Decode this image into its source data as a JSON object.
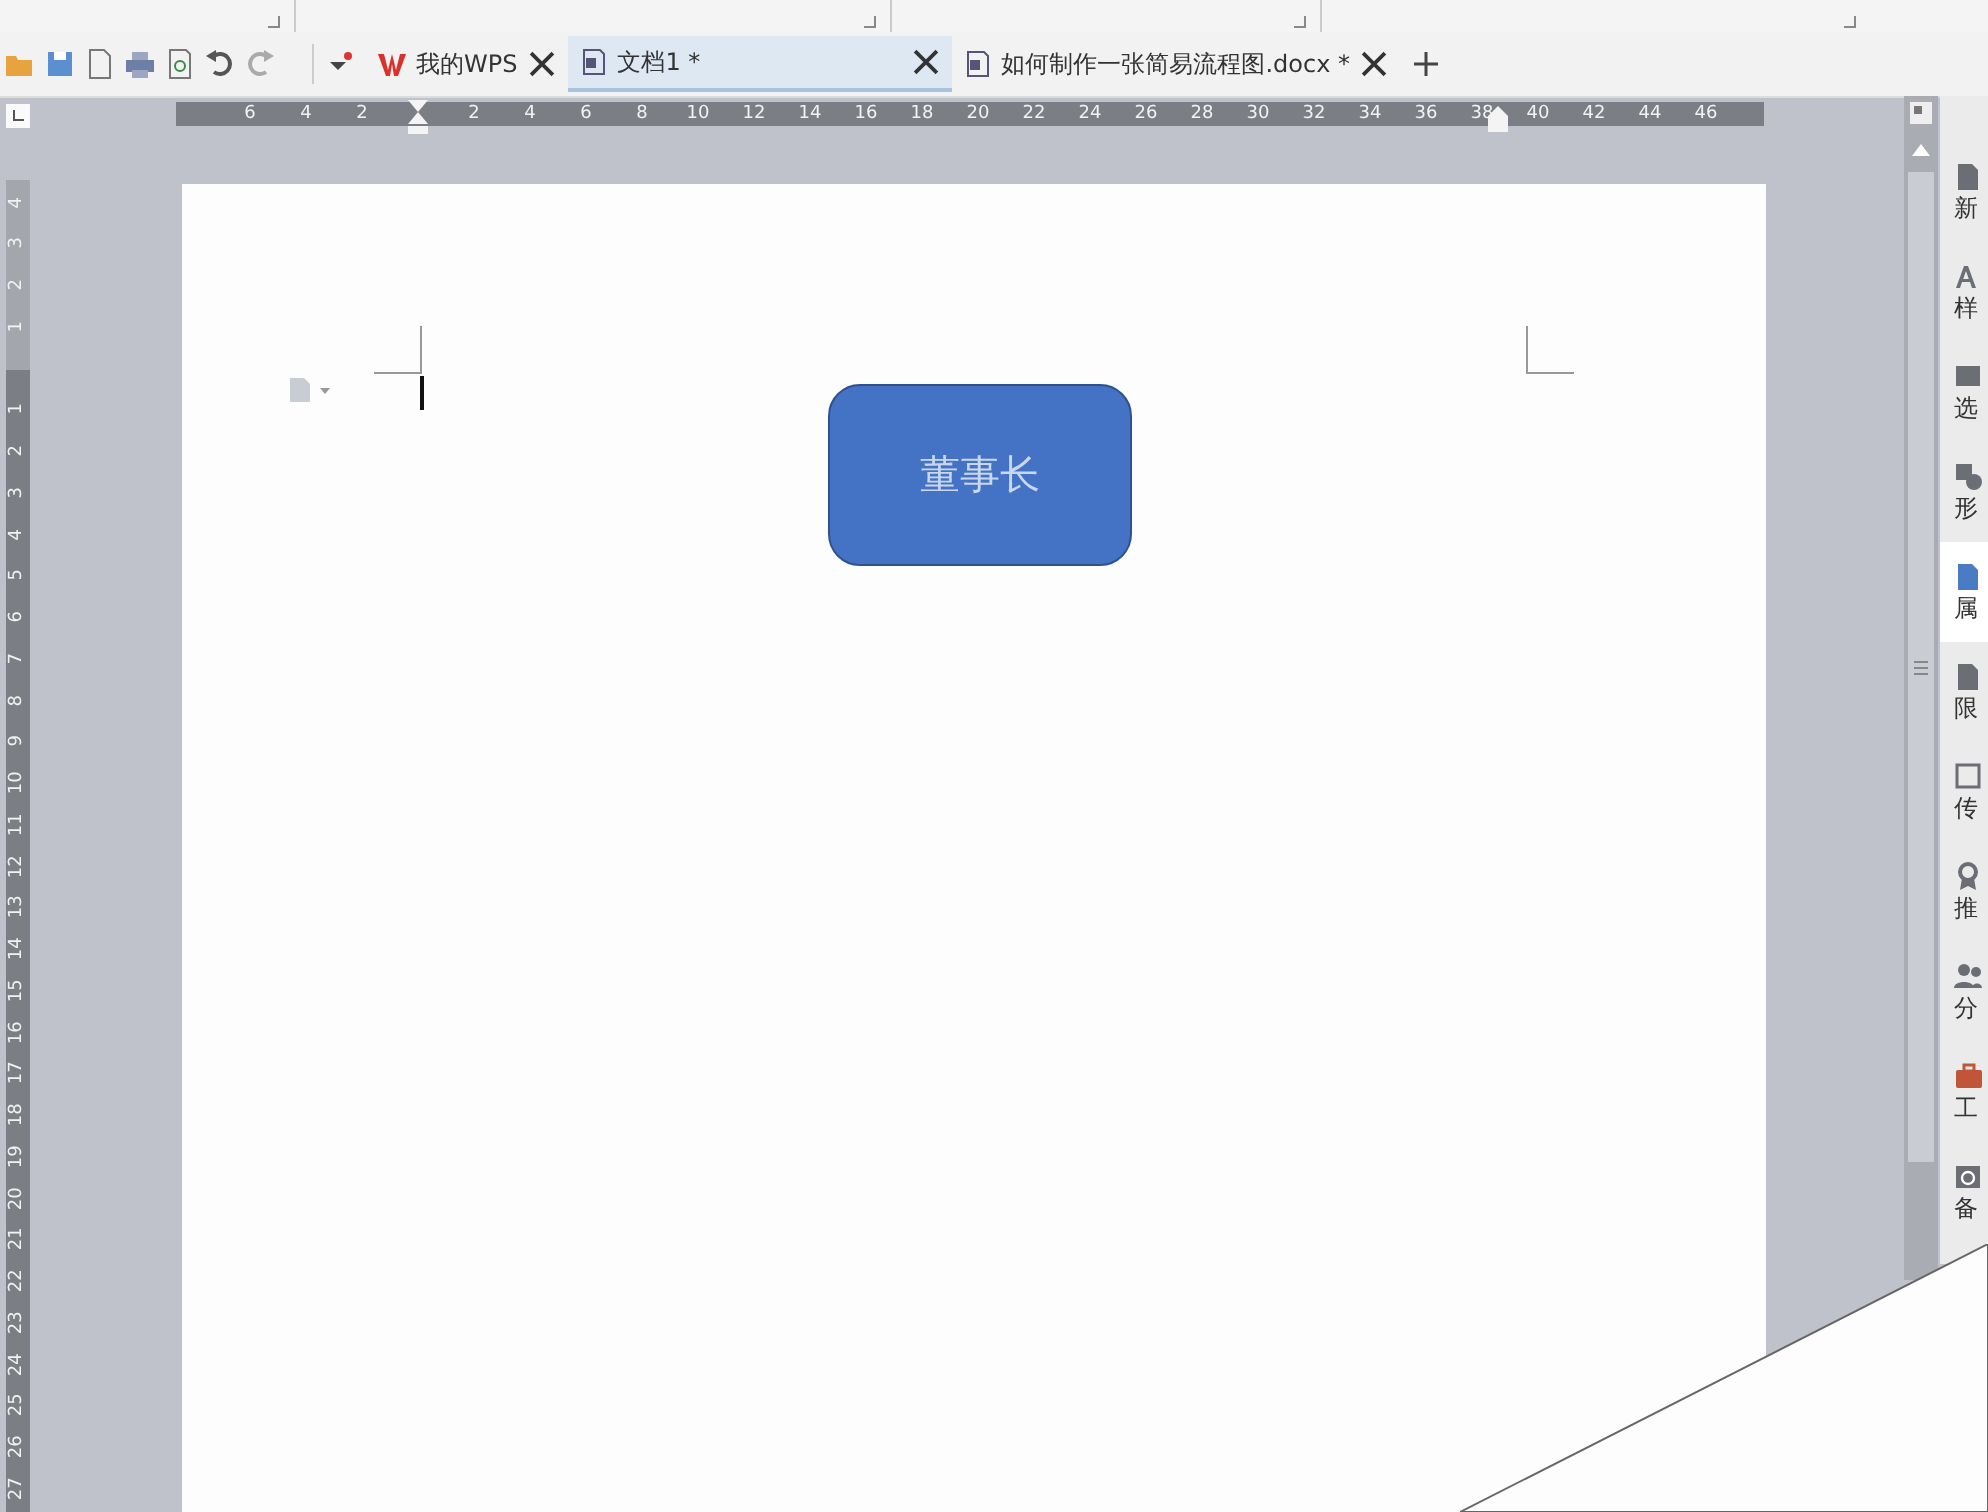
{
  "tabs": [
    {
      "label": "我的WPS",
      "kind": "home",
      "selected": false
    },
    {
      "label": "文档1 *",
      "kind": "doc",
      "selected": true
    },
    {
      "label": "如何制作一张简易流程图.docx *",
      "kind": "doc",
      "selected": false
    }
  ],
  "horizontal_ruler": {
    "left_labels": [
      "6",
      "4",
      "2"
    ],
    "right_labels": [
      "2",
      "4",
      "6",
      "8",
      "10",
      "12",
      "14",
      "16",
      "18",
      "20",
      "22",
      "24",
      "26",
      "28",
      "30",
      "32",
      "34",
      "36",
      "38",
      "40",
      "42",
      "44",
      "46"
    ]
  },
  "vertical_ruler": {
    "top_labels": [
      "4",
      "3",
      "2",
      "1"
    ],
    "body_labels": [
      "1",
      "2",
      "3",
      "4",
      "5",
      "6",
      "7",
      "8",
      "9",
      "10",
      "11",
      "12",
      "13",
      "14",
      "15",
      "16",
      "17",
      "18",
      "19",
      "20",
      "21",
      "22",
      "23",
      "24",
      "25",
      "26",
      "27"
    ]
  },
  "document": {
    "shape": {
      "text": "董事长"
    }
  },
  "sidebar": {
    "items": [
      {
        "label": "新",
        "kind": "new",
        "selected": false
      },
      {
        "label": "样",
        "kind": "style",
        "selected": false
      },
      {
        "label": "选",
        "kind": "select",
        "selected": false
      },
      {
        "label": "形",
        "kind": "shape",
        "selected": false
      },
      {
        "label": "属",
        "kind": "property",
        "selected": true
      },
      {
        "label": "限",
        "kind": "restrict",
        "selected": false
      },
      {
        "label": "传",
        "kind": "image",
        "selected": false
      },
      {
        "label": "推",
        "kind": "recommend",
        "selected": false
      },
      {
        "label": "分",
        "kind": "share",
        "selected": false
      },
      {
        "label": "工",
        "kind": "tools",
        "selected": false
      },
      {
        "label": "备",
        "kind": "backup",
        "selected": false
      }
    ]
  }
}
